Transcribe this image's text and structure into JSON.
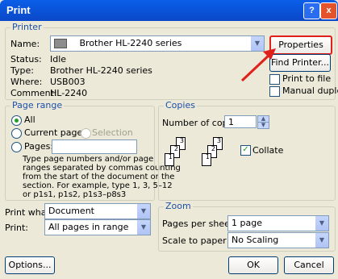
{
  "window": {
    "title": "Print",
    "help_label": "?",
    "close_label": "x"
  },
  "printer": {
    "legend": "Printer",
    "name_label": "Name:",
    "name_value": "Brother HL-2240 series",
    "status_label": "Status:",
    "status_value": "Idle",
    "type_label": "Type:",
    "type_value": "Brother HL-2240 series",
    "where_label": "Where:",
    "where_value": "USB003",
    "comment_label": "Comment:",
    "comment_value": "HL-2240",
    "properties_label": "Properties",
    "find_printer_label": "Find Printer...",
    "print_to_file_label": "Print to file",
    "manual_duplex_label": "Manual duplex"
  },
  "page_range": {
    "legend": "Page range",
    "all_label": "All",
    "current_label": "Current page",
    "selection_label": "Selection",
    "pages_label": "Pages:",
    "pages_value": "",
    "help_text": [
      "Type page numbers and/or page",
      "ranges separated by commas counting",
      "from the start of the document or the",
      "section. For example, type 1, 3, 5–12",
      "or p1s1, p1s2, p1s3–p8s3"
    ]
  },
  "copies": {
    "legend": "Copies",
    "number_label": "Number of copies:",
    "number_value": "1",
    "collate_label": "Collate",
    "collate_checked": true,
    "page_numbers": [
      "3",
      "2",
      "1",
      "3",
      "2",
      "1"
    ]
  },
  "print_what": {
    "label": "Print what:",
    "value": "Document"
  },
  "print": {
    "label": "Print:",
    "value": "All pages in range"
  },
  "zoom": {
    "legend": "Zoom",
    "pages_per_sheet_label": "Pages per sheet:",
    "pages_per_sheet_value": "1 page",
    "scale_label": "Scale to paper size:",
    "scale_value": "No Scaling"
  },
  "footer": {
    "options_label": "Options...",
    "ok_label": "OK",
    "cancel_label": "Cancel"
  },
  "colors": {
    "title_bar": "#0a5ee8",
    "group_label": "#1c4fa8",
    "annotation_arrow": "#e0201b",
    "annotation_highlight": "#e0201b"
  }
}
